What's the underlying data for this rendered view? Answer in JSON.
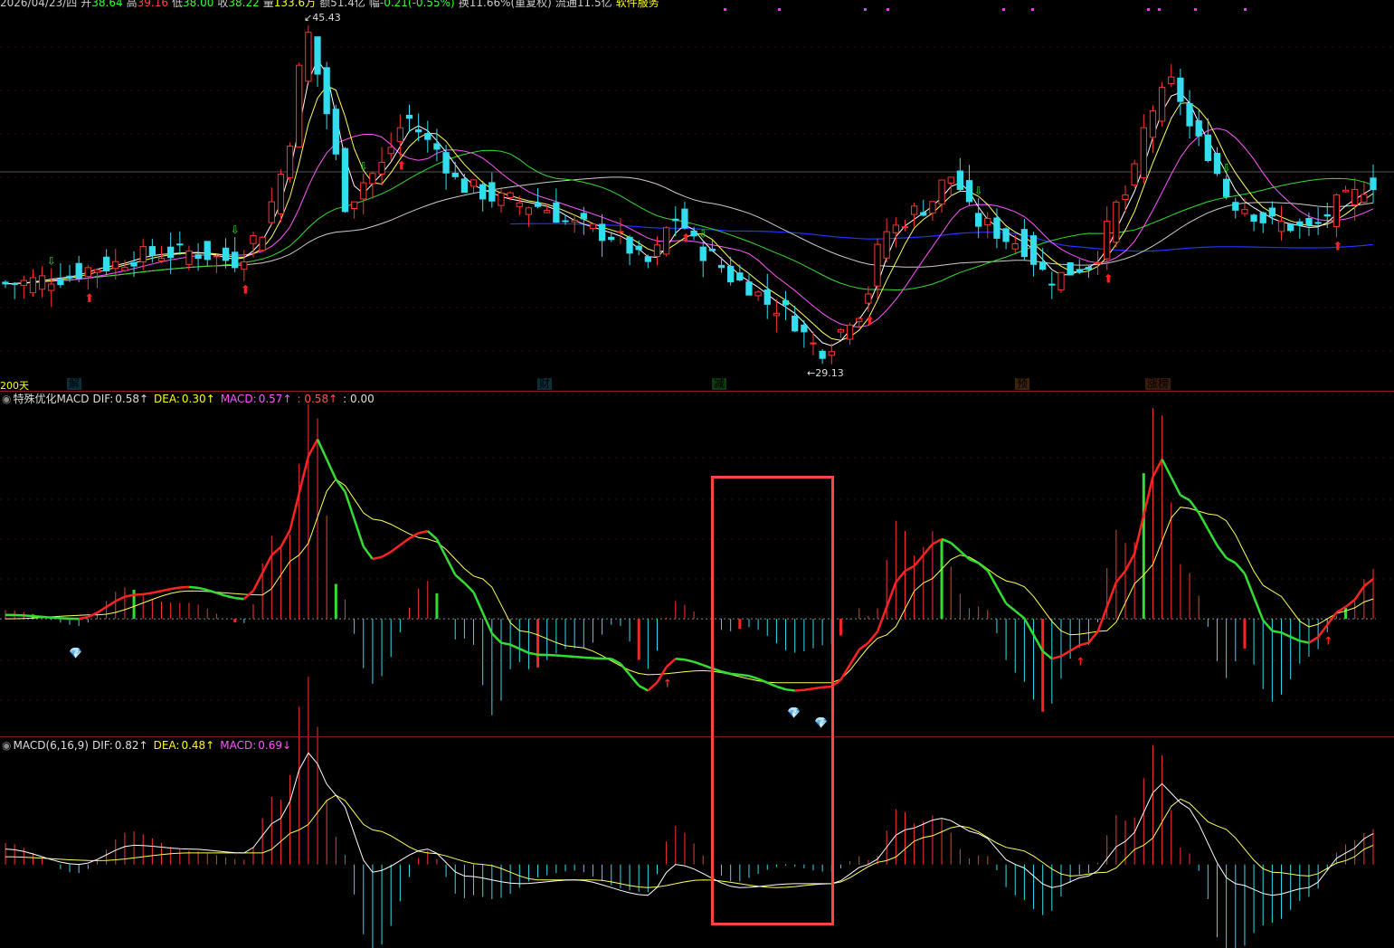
{
  "header": {
    "date": "2026/04/23/四",
    "open_label": "开",
    "open": "38.64",
    "high_label": "高",
    "high": "39.16",
    "low_label": "低",
    "low": "38.00",
    "close_label": "收",
    "close": "38.22",
    "vol_label": "量",
    "vol": "133.6万",
    "amount_label": "额",
    "amount": "51.4亿",
    "change_label": "幅",
    "change": "-0.21(-0.55%)",
    "turnover_text": "换11.66%(重复权)",
    "float_text": "流通11.5亿",
    "service_text": "软件服务"
  },
  "price_pane": {
    "max_label": "45.43",
    "min_label": "29.13",
    "ma_label": "200天",
    "event_tags": [
      {
        "text": "解",
        "color": "#6cf"
      },
      {
        "text": "财",
        "color": "#6cf"
      },
      {
        "text": "减",
        "color": "#3f3"
      },
      {
        "text": "预",
        "color": "#fa3"
      },
      {
        "text": "涨榜",
        "color": "#f84"
      }
    ]
  },
  "panel1": {
    "name": "特殊优化MACD",
    "dif_label": "DIF:",
    "dif": "0.58↑",
    "dea_label": "DEA:",
    "dea": "0.30↑",
    "macd_label": "MACD:",
    "macd": "0.57↑",
    "extra1": ": 0.58↑",
    "extra2": ": 0.00"
  },
  "panel2": {
    "name": "MACD(6,16,9)",
    "dif_label": "DIF:",
    "dif": "0.82↑",
    "dea_label": "DEA:",
    "dea": "0.48↑",
    "macd_label": "MACD:",
    "macd": "0.69↓"
  },
  "colors": {
    "up": "#ff3333",
    "down": "#33ddee",
    "ma5": "#ffffff",
    "ma10": "#ffff55",
    "ma20": "#ff55ff",
    "ma60": "#33dd33",
    "ma120": "#cccccc",
    "ma200": "#2233ff",
    "highlight": "#ff4444"
  },
  "chart_data": {
    "type": "candlestick",
    "count": 150,
    "price_keypoints": [
      [
        0,
        33.4
      ],
      [
        6,
        33.7
      ],
      [
        10,
        34.2
      ],
      [
        16,
        34.8
      ],
      [
        20,
        34.9
      ],
      [
        25,
        34.5
      ],
      [
        28,
        35.9
      ],
      [
        30,
        38.6
      ],
      [
        33,
        45.2
      ],
      [
        35,
        41.5
      ],
      [
        37,
        37.2
      ],
      [
        40,
        38.6
      ],
      [
        44,
        41.2
      ],
      [
        46,
        40.1
      ],
      [
        50,
        38.0
      ],
      [
        54,
        37.4
      ],
      [
        58,
        37.1
      ],
      [
        62,
        36.2
      ],
      [
        66,
        35.7
      ],
      [
        70,
        34.4
      ],
      [
        73,
        36.5
      ],
      [
        76,
        34.9
      ],
      [
        80,
        33.5
      ],
      [
        84,
        32.3
      ],
      [
        89,
        30.3
      ],
      [
        93,
        32.1
      ],
      [
        96,
        35.9
      ],
      [
        100,
        37.0
      ],
      [
        103,
        38.5
      ],
      [
        106,
        36.3
      ],
      [
        110,
        35.4
      ],
      [
        114,
        33.7
      ],
      [
        118,
        34.3
      ],
      [
        122,
        37.6
      ],
      [
        125,
        41.7
      ],
      [
        127,
        42.9
      ],
      [
        130,
        40.1
      ],
      [
        134,
        37.2
      ],
      [
        138,
        36.3
      ],
      [
        142,
        36.0
      ],
      [
        146,
        37.4
      ],
      [
        149,
        38.2
      ]
    ],
    "dif1_keypoints": [
      [
        0,
        0.1
      ],
      [
        8,
        0.0
      ],
      [
        14,
        0.6
      ],
      [
        20,
        0.8
      ],
      [
        26,
        0.5
      ],
      [
        30,
        1.8
      ],
      [
        34,
        4.5
      ],
      [
        36,
        3.5
      ],
      [
        40,
        1.5
      ],
      [
        46,
        2.2
      ],
      [
        50,
        0.9
      ],
      [
        54,
        -0.6
      ],
      [
        58,
        -0.9
      ],
      [
        66,
        -1.0
      ],
      [
        70,
        -1.8
      ],
      [
        73,
        -1.0
      ],
      [
        80,
        -1.4
      ],
      [
        86,
        -1.8
      ],
      [
        90,
        -1.7
      ],
      [
        94,
        -0.6
      ],
      [
        98,
        1.2
      ],
      [
        102,
        2.0
      ],
      [
        106,
        1.4
      ],
      [
        110,
        0.2
      ],
      [
        114,
        -1.0
      ],
      [
        118,
        -0.6
      ],
      [
        122,
        1.2
      ],
      [
        126,
        4.0
      ],
      [
        128,
        3.1
      ],
      [
        134,
        1.4
      ],
      [
        138,
        -0.3
      ],
      [
        142,
        -0.6
      ],
      [
        146,
        0.3
      ],
      [
        149,
        1.0
      ]
    ],
    "dea1_keypoints": [
      [
        0,
        0.0
      ],
      [
        10,
        0.1
      ],
      [
        20,
        0.7
      ],
      [
        28,
        0.6
      ],
      [
        32,
        1.6
      ],
      [
        36,
        3.5
      ],
      [
        40,
        2.5
      ],
      [
        46,
        2.0
      ],
      [
        52,
        1.0
      ],
      [
        56,
        -0.3
      ],
      [
        62,
        -0.7
      ],
      [
        70,
        -1.4
      ],
      [
        76,
        -1.3
      ],
      [
        84,
        -1.6
      ],
      [
        90,
        -1.6
      ],
      [
        96,
        -0.4
      ],
      [
        100,
        0.9
      ],
      [
        104,
        1.6
      ],
      [
        110,
        0.9
      ],
      [
        116,
        -0.4
      ],
      [
        120,
        -0.3
      ],
      [
        124,
        1.1
      ],
      [
        128,
        2.8
      ],
      [
        132,
        2.6
      ],
      [
        138,
        0.7
      ],
      [
        142,
        -0.2
      ],
      [
        146,
        0.2
      ],
      [
        149,
        0.5
      ]
    ],
    "dif2_keypoints": [
      [
        0,
        0.4
      ],
      [
        8,
        0.0
      ],
      [
        14,
        0.5
      ],
      [
        20,
        0.4
      ],
      [
        26,
        0.3
      ],
      [
        30,
        1.2
      ],
      [
        33,
        2.9
      ],
      [
        36,
        1.8
      ],
      [
        40,
        -0.2
      ],
      [
        46,
        0.4
      ],
      [
        50,
        -0.3
      ],
      [
        56,
        -0.5
      ],
      [
        62,
        -0.4
      ],
      [
        70,
        -0.8
      ],
      [
        73,
        0.0
      ],
      [
        80,
        -0.6
      ],
      [
        86,
        -0.5
      ],
      [
        90,
        -0.5
      ],
      [
        94,
        0.0
      ],
      [
        98,
        0.9
      ],
      [
        102,
        1.2
      ],
      [
        106,
        0.8
      ],
      [
        110,
        0.0
      ],
      [
        114,
        -0.6
      ],
      [
        118,
        -0.3
      ],
      [
        122,
        0.6
      ],
      [
        126,
        2.1
      ],
      [
        128,
        1.6
      ],
      [
        134,
        -0.5
      ],
      [
        138,
        -0.8
      ],
      [
        142,
        -0.6
      ],
      [
        146,
        0.3
      ],
      [
        149,
        0.8
      ]
    ],
    "dea2_keypoints": [
      [
        0,
        0.2
      ],
      [
        10,
        0.1
      ],
      [
        20,
        0.3
      ],
      [
        28,
        0.3
      ],
      [
        32,
        0.9
      ],
      [
        36,
        1.8
      ],
      [
        40,
        0.9
      ],
      [
        46,
        0.3
      ],
      [
        52,
        0.0
      ],
      [
        58,
        -0.4
      ],
      [
        64,
        -0.4
      ],
      [
        70,
        -0.6
      ],
      [
        76,
        -0.4
      ],
      [
        84,
        -0.6
      ],
      [
        90,
        -0.5
      ],
      [
        96,
        0.1
      ],
      [
        100,
        0.7
      ],
      [
        104,
        1.0
      ],
      [
        110,
        0.4
      ],
      [
        116,
        -0.3
      ],
      [
        120,
        -0.2
      ],
      [
        124,
        0.5
      ],
      [
        128,
        1.7
      ],
      [
        132,
        1.0
      ],
      [
        138,
        -0.2
      ],
      [
        142,
        -0.3
      ],
      [
        146,
        0.1
      ],
      [
        149,
        0.5
      ]
    ],
    "y_range_price": [
      28.5,
      46.5
    ],
    "y_range_macd1": [
      -2.9,
      5.4
    ],
    "y_range_macd2": [
      -2.1,
      3.0
    ]
  }
}
